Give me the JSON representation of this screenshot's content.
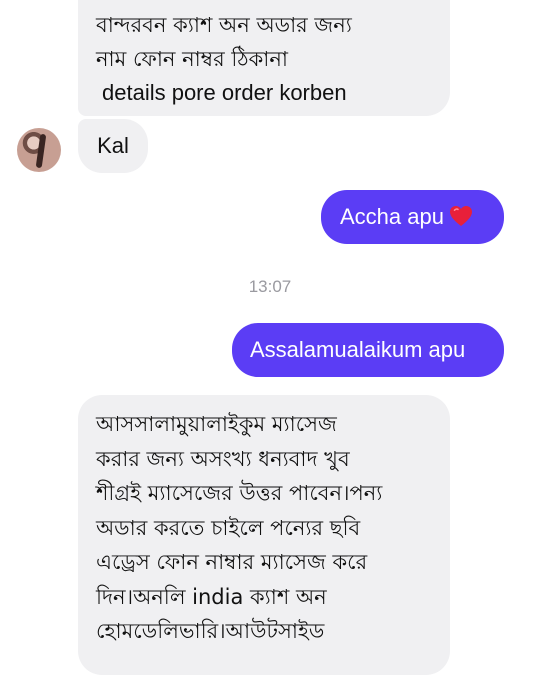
{
  "colors": {
    "accent": "#5b3df5",
    "incoming_bg": "#f0f0f2",
    "heart": "#e8203a"
  },
  "messages": {
    "m1": {
      "lines": [
        "বান্দরবন ক্যাশ অন অডার জন্য",
        "নাম ফোন নাম্বর ঠিকানা",
        "details pore order korben"
      ]
    },
    "m2": {
      "text": "Kal"
    },
    "m3": {
      "text": "Accha apu",
      "emoji": "heart-icon"
    },
    "timestamp": "13:07",
    "m4": {
      "text": "Assalamualaikum apu"
    },
    "m5": {
      "lines": [
        "আসসালামুয়ালাইকুম ম্যাসেজ",
        "করার জন্য অসংখ্য ধন্যবাদ খুব",
        "শীগ্রই ম্যাসেজের উত্তর পাবেন।পন্য",
        "অডার করতে চাইলে পন্যের ছবি",
        "এড্রেস ফোন নাম্বার ম্যাসেজ করে",
        "দিন।অনলি  india ক্যাশ অন",
        "হোমডেলিভারি।আউটসাইড"
      ]
    }
  }
}
